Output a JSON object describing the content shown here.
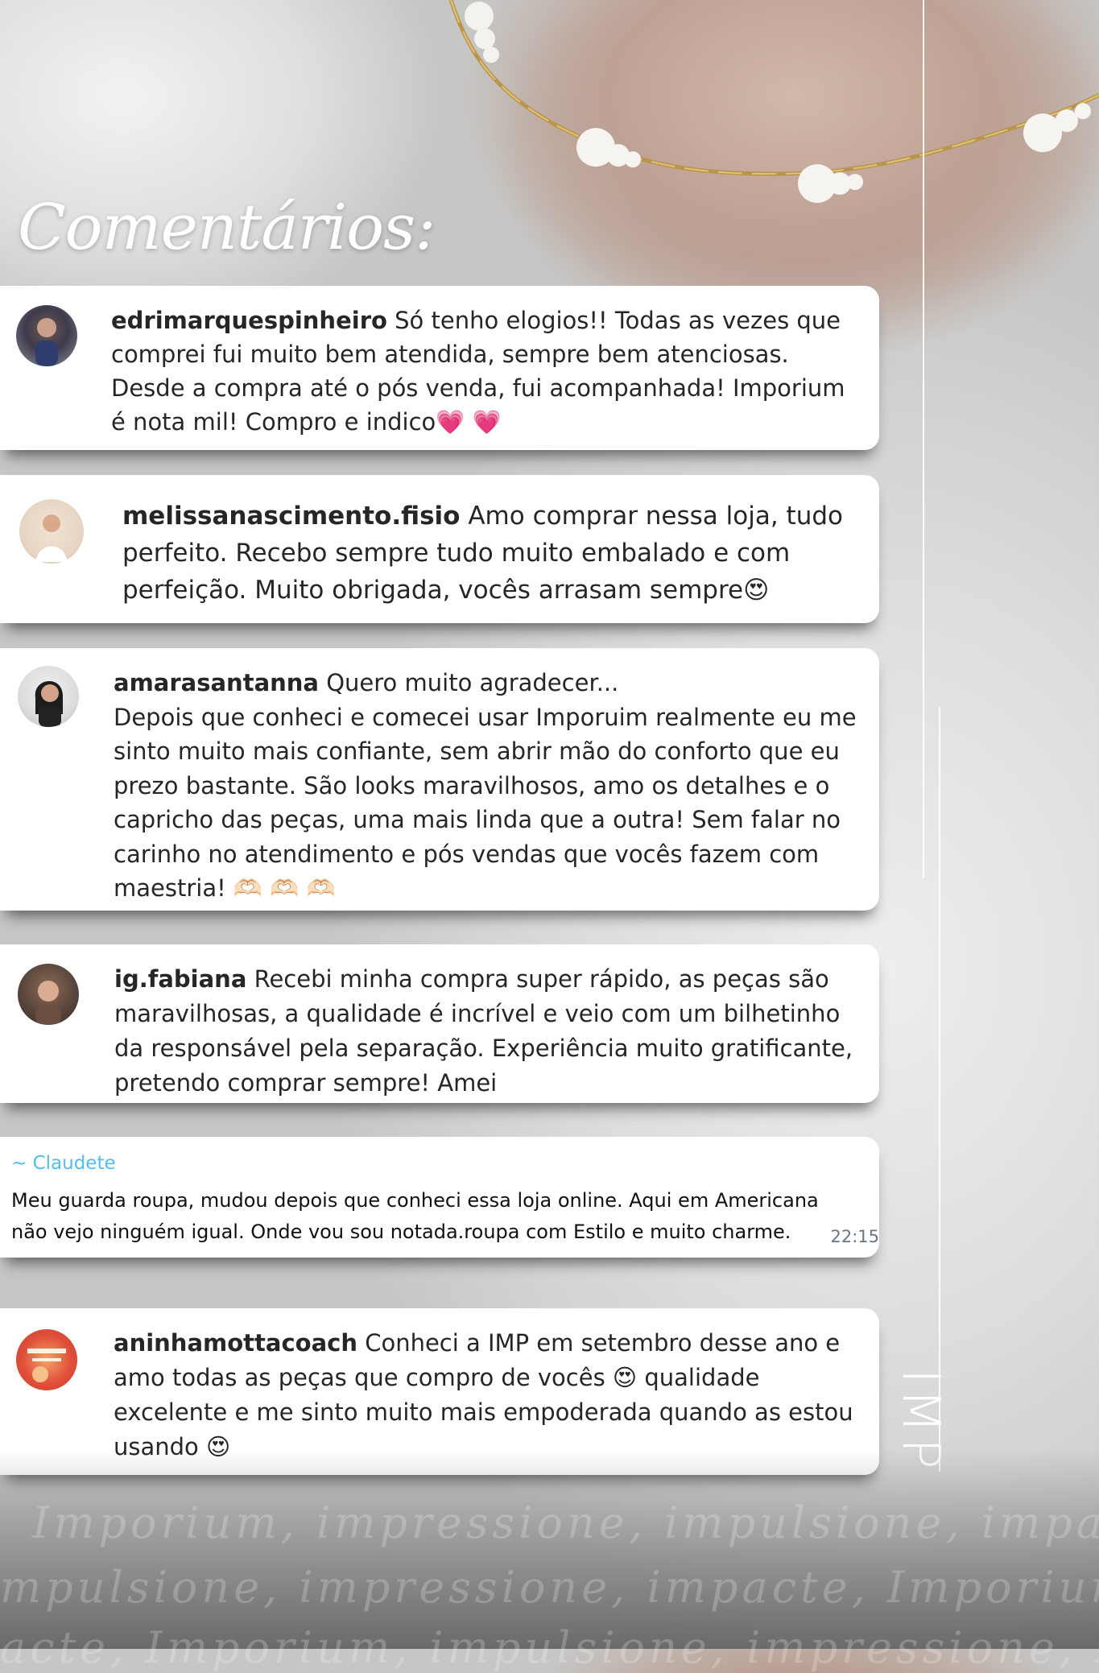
{
  "title": "Comentários:",
  "brand": "IMP",
  "comments": [
    {
      "user": "edrimarquespinheiro",
      "text": " Só tenho elogios!! Todas as vezes que comprei fui muito bem atendida, sempre bem atenciosas. Desde a compra até o pós venda, fui acompanhada! Imporium é nota mil! Compro e indico💗 💗"
    },
    {
      "user": "melissanascimento.fisio",
      "text": " Amo comprar nessa loja, tudo perfeito. Recebo sempre tudo muito embalado e com perfeição. Muito obrigada, vocês arrasam sempre😍"
    },
    {
      "user": "amarasantanna",
      "text": " Quero muito agradecer...",
      "text2": "Depois que conheci e comecei usar Imporuim realmente eu me sinto muito mais confiante, sem abrir mão do conforto que eu prezo bastante. São looks maravilhosos, amo os detalhes e o capricho das peças, uma mais linda que a outra! Sem falar no carinho no atendimento e pós vendas que vocês fazem com maestria! 🫶🏻 🫶🏻 🫶🏻"
    },
    {
      "user": "ig.fabiana",
      "text": " Recebi minha compra super rápido, as peças são maravilhosas, a qualidade é incrível e veio com um bilhetinho da responsável pela separação. Experiência muito gratificante, pretendo comprar sempre! Amei"
    },
    {
      "user": "aninhamottacoach",
      "text": " Conheci a IMP em setembro desse ano e amo todas as peças que compro de vocês 😍 qualidade excelente e me sinto muito mais empoderada quando as estou usando 😍"
    }
  ],
  "whatsapp": {
    "name": "~ Claudete",
    "text": "Meu guarda roupa, mudou depois que conheci essa loja online. Aqui em Americana não vejo ninguém igual. Onde vou sou notada.roupa com Estilo e muito charme.",
    "time": "22:15"
  },
  "watermark": {
    "line1": "Imporium, impressione, impulsione, impacte",
    "line2": "mpulsione, impressione, impacte, Imporium",
    "line3": "acte, Imporium, impulsione, impressione, Im"
  }
}
